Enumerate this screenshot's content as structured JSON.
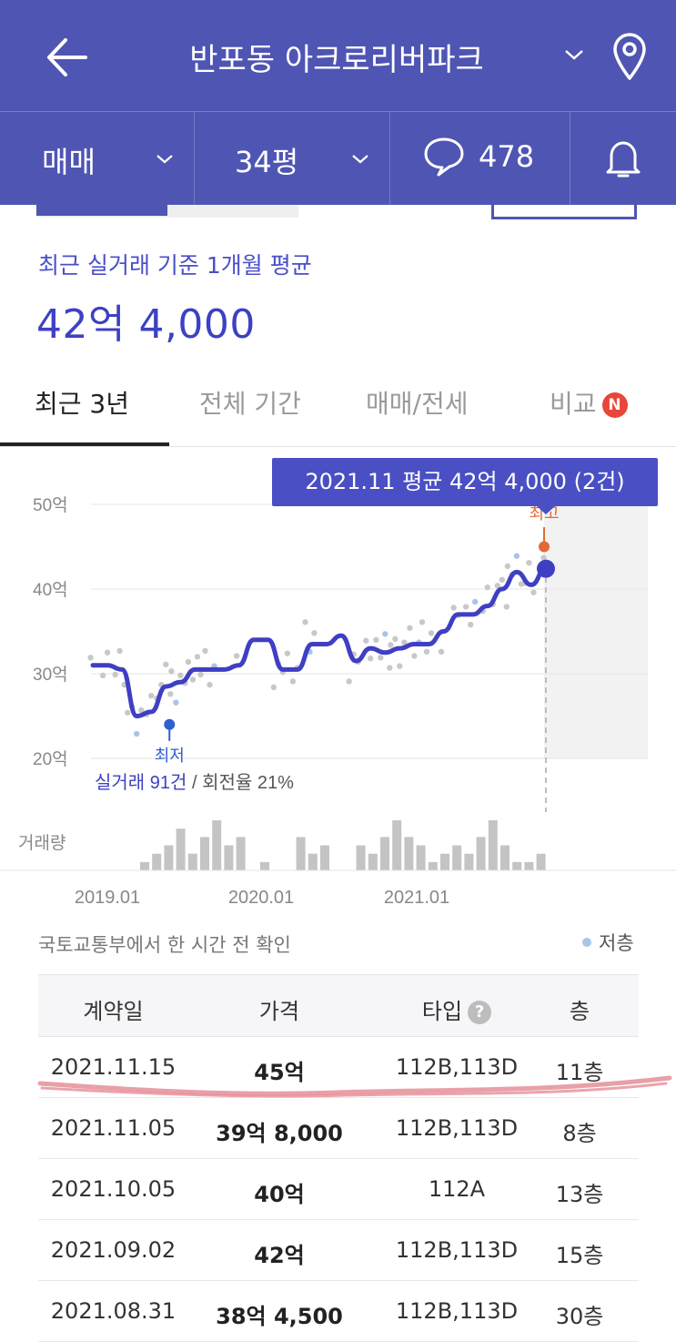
{
  "header": {
    "title": "반포동 아크로리버파크",
    "deal_type": "매매",
    "size": "34평",
    "comment_count": "478",
    "colors": {
      "header_bg": "#4f55b3",
      "accent": "#3d41c2",
      "high": "#e26a3a",
      "low": "#2f5fd0"
    }
  },
  "summary": {
    "label": "최근 실거래 기준 1개월 평균",
    "value": "42억 4,000"
  },
  "tabs": [
    {
      "label": "최근 3년",
      "active": true
    },
    {
      "label": "전체 기간",
      "active": false
    },
    {
      "label": "매매/전세",
      "active": false
    },
    {
      "label": "비교",
      "active": false,
      "badge": "N"
    }
  ],
  "chart": {
    "tooltip": "2021.11 평균 42억 4,000 (2건)",
    "high_label": "최고",
    "low_label": "최저",
    "stats_count": "실거래 91건",
    "stats_sep": " / ",
    "stats_turnover": "회전율 21%",
    "volume_label": "거래량",
    "x_ticks": [
      "2019.01",
      "2020.01",
      "2021.01"
    ]
  },
  "chart_data": {
    "type": "line",
    "y_unit": "억",
    "ylim": [
      20,
      50
    ],
    "y_ticks": [
      "20억",
      "30억",
      "40억",
      "50억"
    ],
    "x": [
      "2018.11",
      "2018.12",
      "2019.01",
      "2019.02",
      "2019.03",
      "2019.04",
      "2019.05",
      "2019.06",
      "2019.07",
      "2019.08",
      "2019.09",
      "2019.10",
      "2019.11",
      "2019.12",
      "2020.01",
      "2020.02",
      "2020.03",
      "2020.04",
      "2020.05",
      "2020.06",
      "2020.07",
      "2020.08",
      "2020.09",
      "2020.10",
      "2020.11",
      "2020.12",
      "2021.01",
      "2021.02",
      "2021.03",
      "2021.04",
      "2021.05",
      "2021.06",
      "2021.07",
      "2021.08",
      "2021.09",
      "2021.10",
      "2021.11"
    ],
    "series": [
      {
        "values": [
          31,
          31,
          30.5,
          25,
          25.5,
          28.5,
          29,
          30.5,
          30.5,
          30.5,
          31,
          34,
          34,
          30.5,
          30.5,
          33.5,
          33.5,
          34.5,
          31.5,
          33,
          32.5,
          33,
          33.5,
          33.5,
          35,
          37,
          37,
          38,
          40,
          42,
          40.5,
          42.4,
          null,
          null,
          null,
          null,
          null
        ]
      }
    ],
    "high_value": 45,
    "low_value": 24,
    "latest_avg": 42.4,
    "volume": [
      1,
      2,
      3,
      5,
      2,
      4,
      6,
      3,
      4,
      0,
      1,
      0,
      0,
      4,
      2,
      3,
      0,
      0,
      3,
      2,
      4,
      6,
      4,
      3,
      1,
      2,
      3,
      2,
      4,
      6,
      3,
      1,
      1,
      2
    ]
  },
  "transactions": {
    "source_note": "국토교통부에서 한 시간 전 확인",
    "legend_low_floor": "저층",
    "headers": {
      "date": "계약일",
      "price": "가격",
      "type": "타입",
      "floor": "층",
      "help": "?"
    },
    "rows": [
      {
        "date": "2021.11.15",
        "price": "45억",
        "type": "112B,113D",
        "floor": "11층"
      },
      {
        "date": "2021.11.05",
        "price": "39억 8,000",
        "type": "112B,113D",
        "floor": "8층"
      },
      {
        "date": "2021.10.05",
        "price": "40억",
        "type": "112A",
        "floor": "13층"
      },
      {
        "date": "2021.09.02",
        "price": "42억",
        "type": "112B,113D",
        "floor": "15층"
      },
      {
        "date": "2021.08.31",
        "price": "38억 4,500",
        "type": "112B,113D",
        "floor": "30층"
      }
    ]
  }
}
